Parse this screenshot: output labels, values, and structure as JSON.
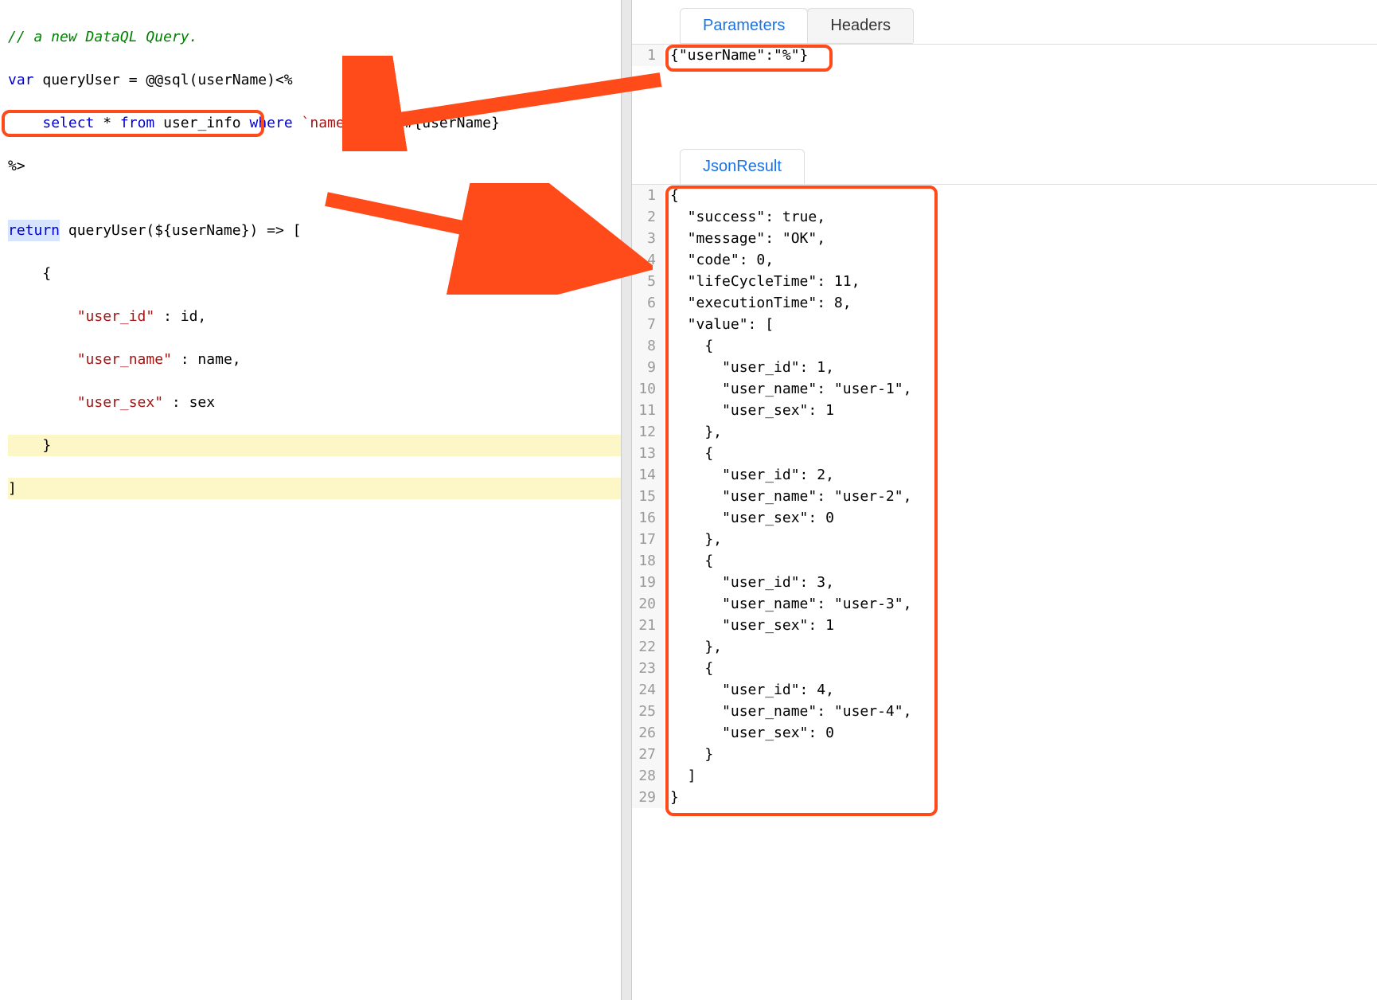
{
  "leftEditor": {
    "comment": "// a new DataQL Query.",
    "varDecl": "var queryUser = @@sql(userName)<%",
    "sqlLine": "    select * from user_info where `name` like #{userName}",
    "closeTag": "%>",
    "blank": "",
    "returnLine": "return queryUser(${userName}) => [",
    "objOpen": "    {",
    "f1": "        \"user_id\" : id,",
    "f2": "        \"user_name\" : name,",
    "f3": "        \"user_sex\" : sex",
    "objClose": "    }",
    "arrClose": "]"
  },
  "tabs": {
    "parameters": "Parameters",
    "headers": "Headers",
    "jsonResult": "JsonResult"
  },
  "paramEditor": {
    "lineNum": "1",
    "content": "{\"userName\":\"%\"}"
  },
  "resultEditor": {
    "lines": [
      "{",
      "  \"success\": true,",
      "  \"message\": \"OK\",",
      "  \"code\": 0,",
      "  \"lifeCycleTime\": 11,",
      "  \"executionTime\": 8,",
      "  \"value\": [",
      "    {",
      "      \"user_id\": 1,",
      "      \"user_name\": \"user-1\",",
      "      \"user_sex\": 1",
      "    },",
      "    {",
      "      \"user_id\": 2,",
      "      \"user_name\": \"user-2\",",
      "      \"user_sex\": 0",
      "    },",
      "    {",
      "      \"user_id\": 3,",
      "      \"user_name\": \"user-3\",",
      "      \"user_sex\": 1",
      "    },",
      "    {",
      "      \"user_id\": 4,",
      "      \"user_name\": \"user-4\",",
      "      \"user_sex\": 0",
      "    }",
      "  ]",
      "}"
    ]
  }
}
